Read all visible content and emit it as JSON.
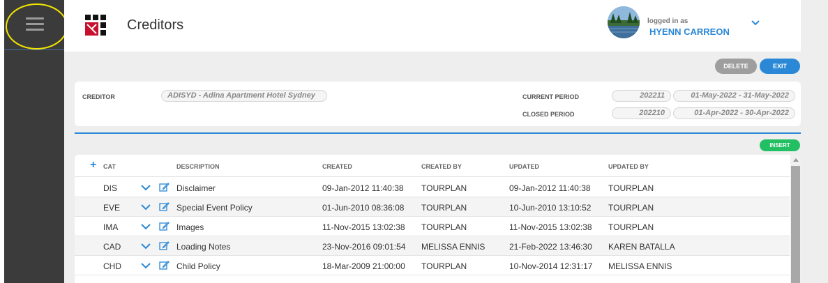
{
  "header": {
    "title": "Creditors",
    "logged_in_label": "logged in as",
    "user_name": "HYENN CARREON"
  },
  "actions": {
    "delete_label": "DELETE",
    "exit_label": "EXIT",
    "insert_label": "INSERT"
  },
  "creditor_info": {
    "creditor_label": "CREDITOR",
    "creditor_value": "ADISYD - Adina Apartment Hotel Sydney",
    "current_period_label": "CURRENT PERIOD",
    "current_period_code": "202211",
    "current_period_range": "01-May-2022 - 31-May-2022",
    "closed_period_label": "CLOSED PERIOD",
    "closed_period_code": "202210",
    "closed_period_range": "01-Apr-2022 - 30-Apr-2022"
  },
  "table": {
    "add_symbol": "+",
    "columns": [
      "CAT",
      "DESCRIPTION",
      "CREATED",
      "CREATED BY",
      "UPDATED",
      "UPDATED BY"
    ],
    "rows": [
      {
        "cat": "DIS",
        "description": "Disclaimer",
        "created": "09-Jan-2012 11:40:38",
        "created_by": "TOURPLAN",
        "updated": "09-Jan-2012 11:40:38",
        "updated_by": "TOURPLAN"
      },
      {
        "cat": "EVE",
        "description": "Special Event Policy",
        "created": "01-Jun-2010 08:36:08",
        "created_by": "TOURPLAN",
        "updated": "10-Jun-2010 13:10:52",
        "updated_by": "TOURPLAN"
      },
      {
        "cat": "IMA",
        "description": "Images",
        "created": "11-Nov-2015 13:02:38",
        "created_by": "TOURPLAN",
        "updated": "11-Nov-2015 13:02:38",
        "updated_by": "TOURPLAN"
      },
      {
        "cat": "CAD",
        "description": "Loading Notes",
        "created": "23-Nov-2016 09:01:54",
        "created_by": "MELISSA ENNIS",
        "updated": "21-Feb-2022 13:46:30",
        "updated_by": "KAREN BATALLA"
      },
      {
        "cat": "CHD",
        "description": "Child Policy",
        "created": "18-Mar-2009 21:00:00",
        "created_by": "TOURPLAN",
        "updated": "10-Nov-2014 12:31:17",
        "updated_by": "MELISSA ENNIS"
      }
    ]
  },
  "colors": {
    "accent": "#2a88d6",
    "insert": "#23bf63",
    "delete": "#9e9e9e",
    "sidebar": "#3b3b3b",
    "highlight": "#f2e600",
    "logo_red": "#c8102e"
  }
}
